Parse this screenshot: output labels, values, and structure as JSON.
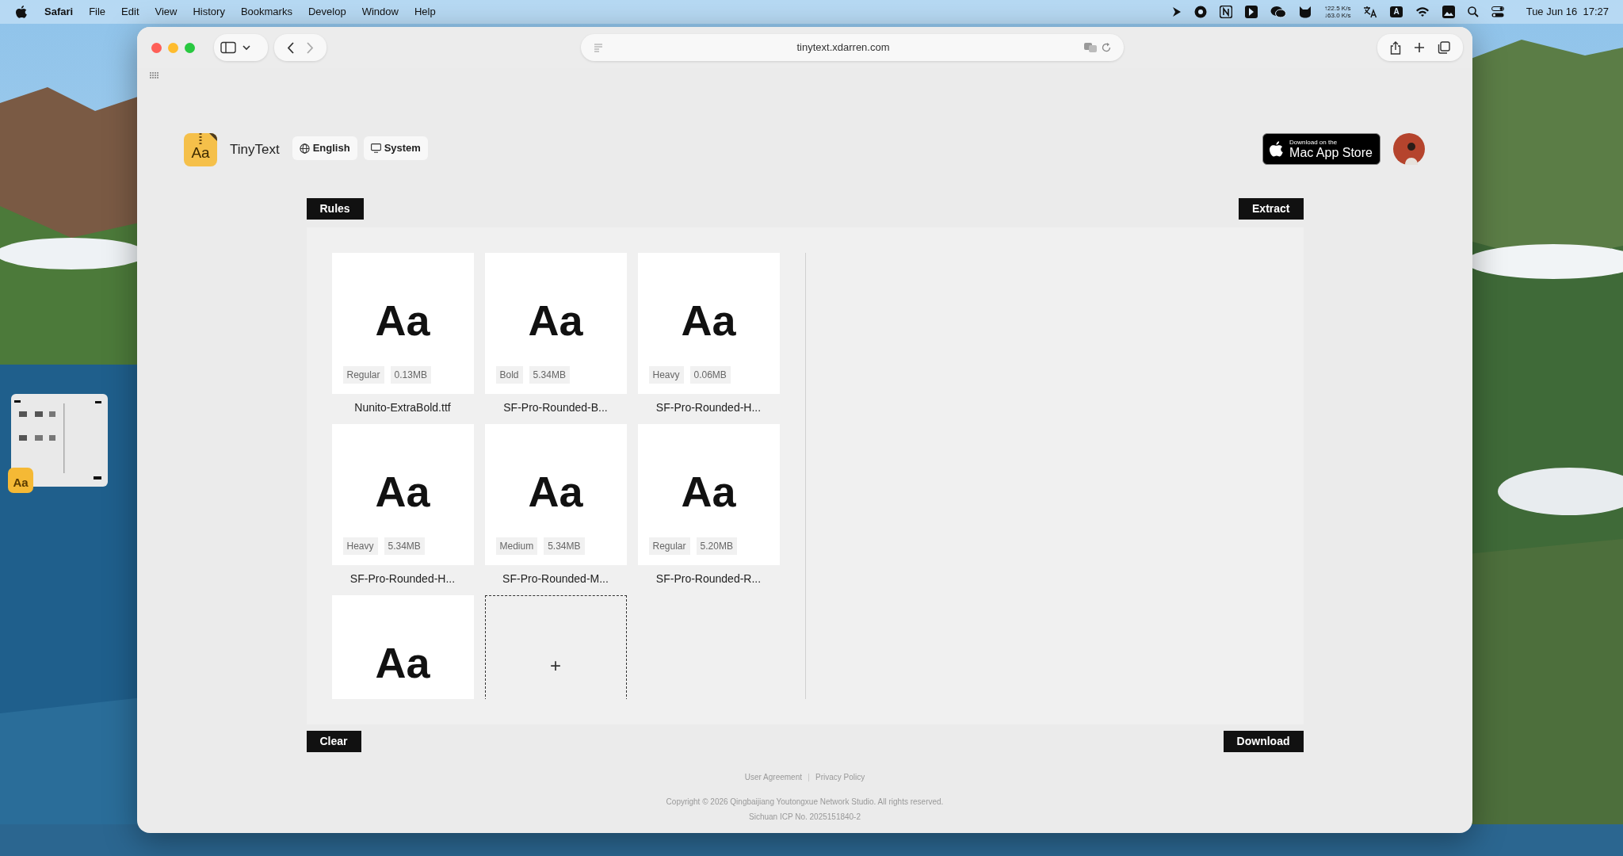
{
  "menu_bar": {
    "app": "Safari",
    "menus": [
      "File",
      "Edit",
      "View",
      "History",
      "Bookmarks",
      "Develop",
      "Window",
      "Help"
    ],
    "net_speed": [
      "↑22.5 K/s",
      "↓63.0 K/s"
    ],
    "input_source": "A",
    "clock": "Tue Jun 16  17:27"
  },
  "desktop": {
    "file_icon_text": "Aa"
  },
  "browser": {
    "address": "tinytext.xdarren.com"
  },
  "header": {
    "logo_text": "Aa",
    "app_name": "TinyText",
    "language": "English",
    "theme": "System",
    "store_badge": {
      "small": "Download on the",
      "large": "Mac App Store"
    }
  },
  "buttons": {
    "rules": "Rules",
    "extract": "Extract",
    "clear": "Clear",
    "download": "Download"
  },
  "items": [
    {
      "kind": "font",
      "sample": "Aa",
      "weight": "Regular",
      "size": "0.13MB",
      "file": "Nunito-ExtraBold.ttf"
    },
    {
      "kind": "font",
      "sample": "Aa",
      "weight": "Bold",
      "size": "5.34MB",
      "file": "SF-Pro-Rounded-B..."
    },
    {
      "kind": "font",
      "sample": "Aa",
      "weight": "Heavy",
      "size": "0.06MB",
      "file": "SF-Pro-Rounded-H..."
    },
    {
      "kind": "font",
      "sample": "Aa",
      "weight": "Heavy",
      "size": "5.34MB",
      "file": "SF-Pro-Rounded-H..."
    },
    {
      "kind": "font",
      "sample": "Aa",
      "weight": "Medium",
      "size": "5.34MB",
      "file": "SF-Pro-Rounded-M..."
    },
    {
      "kind": "font",
      "sample": "Aa",
      "weight": "Regular",
      "size": "5.20MB",
      "file": "SF-Pro-Rounded-R..."
    },
    {
      "kind": "font",
      "sample": "Aa"
    },
    {
      "kind": "add",
      "label": "+"
    }
  ],
  "footer": {
    "links": [
      "User Agreement",
      "Privacy Policy"
    ],
    "copyright": "Copyright © 2026 Qingbaijiang Youtongxue Network Studio. All rights reserved.",
    "icp": "Sichuan ICP No. 2025151840-2"
  }
}
